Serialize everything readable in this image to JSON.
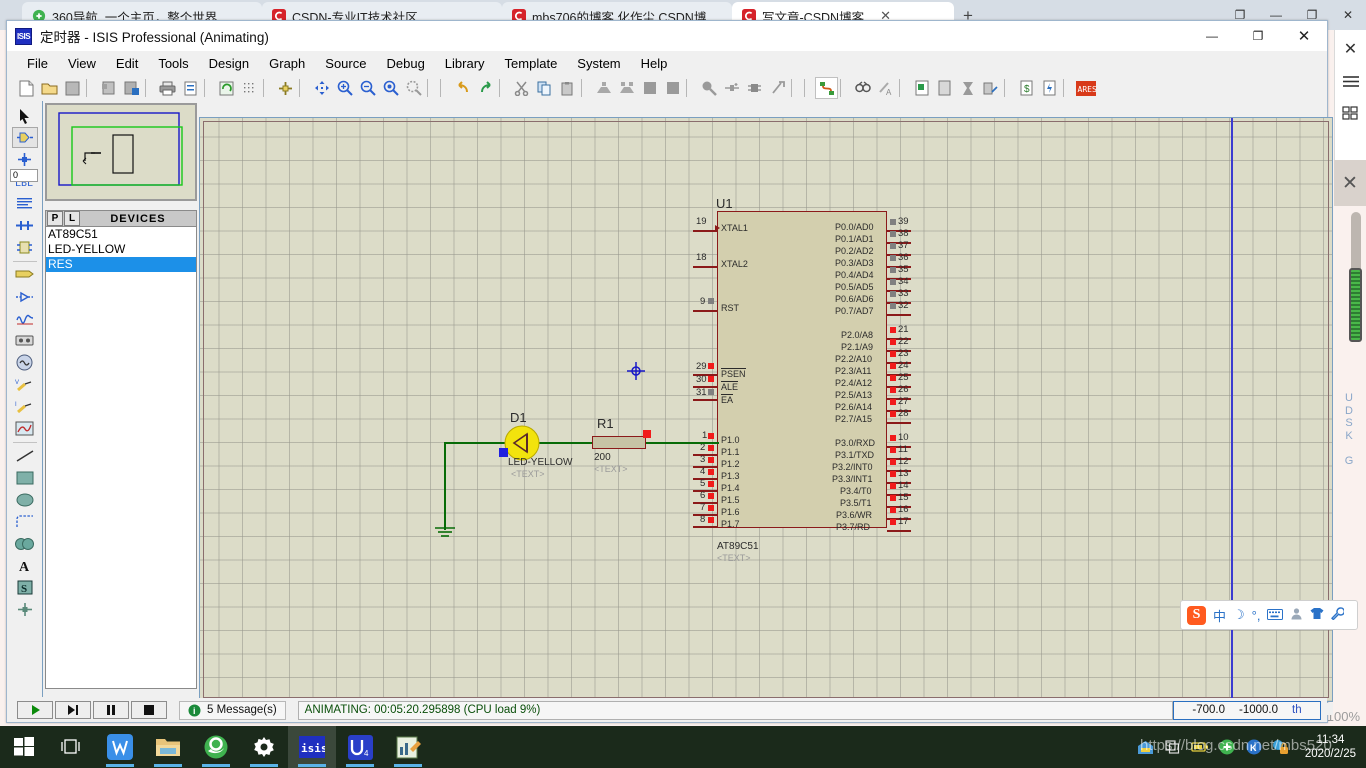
{
  "browser": {
    "tabs": [
      {
        "title": "360导航_一个主页，整个世界",
        "favicon": "360-icon",
        "active": false
      },
      {
        "title": "CSDN-专业IT技术社区",
        "favicon": "csdn-icon",
        "active": false
      },
      {
        "title": "mbs706的博客 化作尘 CSDN博",
        "favicon": "csdn-icon",
        "active": false
      },
      {
        "title": "写文章-CSDN博客",
        "favicon": "csdn-icon",
        "active": true
      }
    ],
    "new_tab_label": "+",
    "close_tab_label": "✕",
    "window_controls": [
      "❐",
      "—",
      "❐",
      "✕"
    ],
    "rail_icons": [
      "close-icon",
      "menu-icon",
      "apps-icon"
    ],
    "rail_close": "✕",
    "vertical_text": "U\nD\nS\nK\n\nG",
    "zoom_level": "100%"
  },
  "isis": {
    "title": "定时器 - ISIS Professional (Animating)",
    "logo_text": "ISIS",
    "window_controls": {
      "minimize": "—",
      "maximize": "❐",
      "close": "✕"
    },
    "menu": [
      "File",
      "View",
      "Edit",
      "Tools",
      "Design",
      "Graph",
      "Source",
      "Debug",
      "Library",
      "Template",
      "System",
      "Help"
    ],
    "toolbar_icons": [
      "new-file-icon",
      "open-file-icon",
      "save-file-icon",
      "import-icon",
      "export-icon",
      "print-icon",
      "print-area-icon",
      "refresh-icon",
      "grid-icon",
      "origin-icon",
      "pan-icon",
      "zoom-in-icon",
      "zoom-out-icon",
      "zoom-all-icon",
      "zoom-area-icon",
      "undo-icon",
      "redo-icon",
      "cut-icon",
      "copy-icon",
      "paste-icon",
      "block-copy-icon",
      "block-move-icon",
      "block-rotate-icon",
      "block-delete-icon",
      "pick-device-icon",
      "make-device-icon",
      "packaging-icon",
      "decompose-icon",
      "wire-autorouter-icon",
      "search-tag-icon",
      "property-assign-icon",
      "design-explorer-icon",
      "new-sheet-icon",
      "remove-sheet-icon",
      "exit-sheet-icon",
      "bill-materials-icon",
      "erc-report-icon",
      "ares-icon"
    ],
    "left_tools": [
      "selection-mode-icon",
      "component-mode-icon",
      "junction-dot-icon",
      "wire-label-icon",
      "text-script-icon",
      "bus-icon",
      "subcircuit-icon",
      "terminals-icon",
      "device-pin-icon",
      "graph-icon",
      "tape-recorder-icon",
      "generator-icon",
      "voltage-probe-icon",
      "current-probe-icon",
      "virtual-instrument-icon",
      "line-icon",
      "box-icon",
      "circle-icon",
      "arc-icon",
      "path-icon",
      "text-icon",
      "symbol-icon",
      "marker-icon"
    ],
    "rotation_value": "0",
    "rotation_icons": [
      "rotate-anticlockwise-icon",
      "rotate-clockwise-icon",
      "mirror-horizontal-icon",
      "mirror-vertical-icon"
    ],
    "devices_panel": {
      "title": "DEVICES",
      "buttons": [
        "P",
        "L"
      ],
      "items": [
        {
          "name": "AT89C51",
          "selected": false
        },
        {
          "name": "LED-YELLOW",
          "selected": false
        },
        {
          "name": "RES",
          "selected": true
        }
      ]
    },
    "status": {
      "animation_buttons": [
        "play-icon",
        "step-icon",
        "pause-icon",
        "stop-icon"
      ],
      "messages": "5 Message(s)",
      "animating": "ANIMATING: 00:05:20.295898 (CPU load 9%)",
      "coord_x": "-700.0",
      "coord_y": "-1000.0",
      "coord_unit": "th"
    }
  },
  "schematic": {
    "ic": {
      "ref": "U1",
      "value": "AT89C51",
      "text_placeholder": "<TEXT>",
      "left_pins": [
        {
          "num": "19",
          "name": "XTAL1",
          "marker": "none"
        },
        {
          "num": "18",
          "name": "XTAL2",
          "marker": "none"
        },
        {
          "num": "9",
          "name": "RST",
          "marker": "grey"
        },
        {
          "num": "29",
          "name": "PSEN",
          "marker": "red",
          "overline": true
        },
        {
          "num": "30",
          "name": "ALE",
          "marker": "red",
          "overline": true
        },
        {
          "num": "31",
          "name": "EA",
          "marker": "grey",
          "overline": true
        },
        {
          "num": "1",
          "name": "P1.0",
          "marker": "red"
        },
        {
          "num": "2",
          "name": "P1.1",
          "marker": "red"
        },
        {
          "num": "3",
          "name": "P1.2",
          "marker": "red"
        },
        {
          "num": "4",
          "name": "P1.3",
          "marker": "red"
        },
        {
          "num": "5",
          "name": "P1.4",
          "marker": "red"
        },
        {
          "num": "6",
          "name": "P1.5",
          "marker": "red"
        },
        {
          "num": "7",
          "name": "P1.6",
          "marker": "red"
        },
        {
          "num": "8",
          "name": "P1.7",
          "marker": "red"
        }
      ],
      "right_pins": [
        {
          "num": "39",
          "name": "P0.0/AD0",
          "marker": "grey"
        },
        {
          "num": "38",
          "name": "P0.1/AD1",
          "marker": "grey"
        },
        {
          "num": "37",
          "name": "P0.2/AD2",
          "marker": "grey"
        },
        {
          "num": "36",
          "name": "P0.3/AD3",
          "marker": "grey"
        },
        {
          "num": "35",
          "name": "P0.4/AD4",
          "marker": "grey"
        },
        {
          "num": "34",
          "name": "P0.5/AD5",
          "marker": "grey"
        },
        {
          "num": "33",
          "name": "P0.6/AD6",
          "marker": "grey"
        },
        {
          "num": "32",
          "name": "P0.7/AD7",
          "marker": "grey"
        },
        {
          "num": "21",
          "name": "P2.0/A8",
          "marker": "red"
        },
        {
          "num": "22",
          "name": "P2.1/A9",
          "marker": "red"
        },
        {
          "num": "23",
          "name": "P2.2/A10",
          "marker": "red"
        },
        {
          "num": "24",
          "name": "P2.3/A11",
          "marker": "red"
        },
        {
          "num": "25",
          "name": "P2.4/A12",
          "marker": "red"
        },
        {
          "num": "26",
          "name": "P2.5/A13",
          "marker": "red"
        },
        {
          "num": "27",
          "name": "P2.6/A14",
          "marker": "red"
        },
        {
          "num": "28",
          "name": "P2.7/A15",
          "marker": "red"
        },
        {
          "num": "10",
          "name": "P3.0/RXD",
          "marker": "red"
        },
        {
          "num": "11",
          "name": "P3.1/TXD",
          "marker": "red"
        },
        {
          "num": "12",
          "name": "P3.2/INT0",
          "marker": "red"
        },
        {
          "num": "13",
          "name": "P3.3/INT1",
          "marker": "red"
        },
        {
          "num": "14",
          "name": "P3.4/T0",
          "marker": "red"
        },
        {
          "num": "15",
          "name": "P3.5/T1",
          "marker": "red"
        },
        {
          "num": "16",
          "name": "P3.6/WR",
          "marker": "red"
        },
        {
          "num": "17",
          "name": "P3.7/RD",
          "marker": "red"
        }
      ]
    },
    "led": {
      "ref": "D1",
      "value": "LED-YELLOW",
      "text_placeholder": "<TEXT>",
      "state_color": "#f2e30d",
      "lit": true
    },
    "resistor": {
      "ref": "R1",
      "value": "200",
      "text_placeholder": "<TEXT>"
    },
    "colors": {
      "wire": "#076b07",
      "body_fill": "#d3cfae",
      "body_stroke": "#8b1a1a",
      "pin_red": "#f11b1b",
      "pin_grey": "#808080",
      "grid": "#dcdcc8"
    }
  },
  "ime": {
    "logo": "S",
    "items": [
      "中",
      "☽",
      "°,",
      "keyboard-icon",
      "user-icon",
      "shirt-icon",
      "wrench-icon"
    ]
  },
  "taskbar": {
    "items": [
      {
        "name": "start-button",
        "icon": "windows-icon"
      },
      {
        "name": "task-view-button",
        "icon": "task-view-icon"
      },
      {
        "name": "taskbar-wps",
        "icon": "wps-icon",
        "running": true
      },
      {
        "name": "taskbar-explorer",
        "icon": "folder-icon",
        "running": true
      },
      {
        "name": "taskbar-browser",
        "icon": "ie-icon",
        "running": true
      },
      {
        "name": "taskbar-settings",
        "icon": "gear-icon",
        "running": true
      },
      {
        "name": "taskbar-isis",
        "icon": "isis-icon",
        "running": true,
        "active": true
      },
      {
        "name": "taskbar-keil",
        "icon": "keil-icon",
        "running": true
      },
      {
        "name": "taskbar-editor",
        "icon": "editor-icon",
        "running": true
      }
    ],
    "tray_icons": [
      "notify-icon",
      "window-icon",
      "battery-icon",
      "360-icon",
      "kingsoft-icon",
      "security-icon"
    ],
    "clock_time": "11:34",
    "clock_date": "2020/2/25"
  },
  "watermark": "https://blog.csdn.net/mbs520"
}
